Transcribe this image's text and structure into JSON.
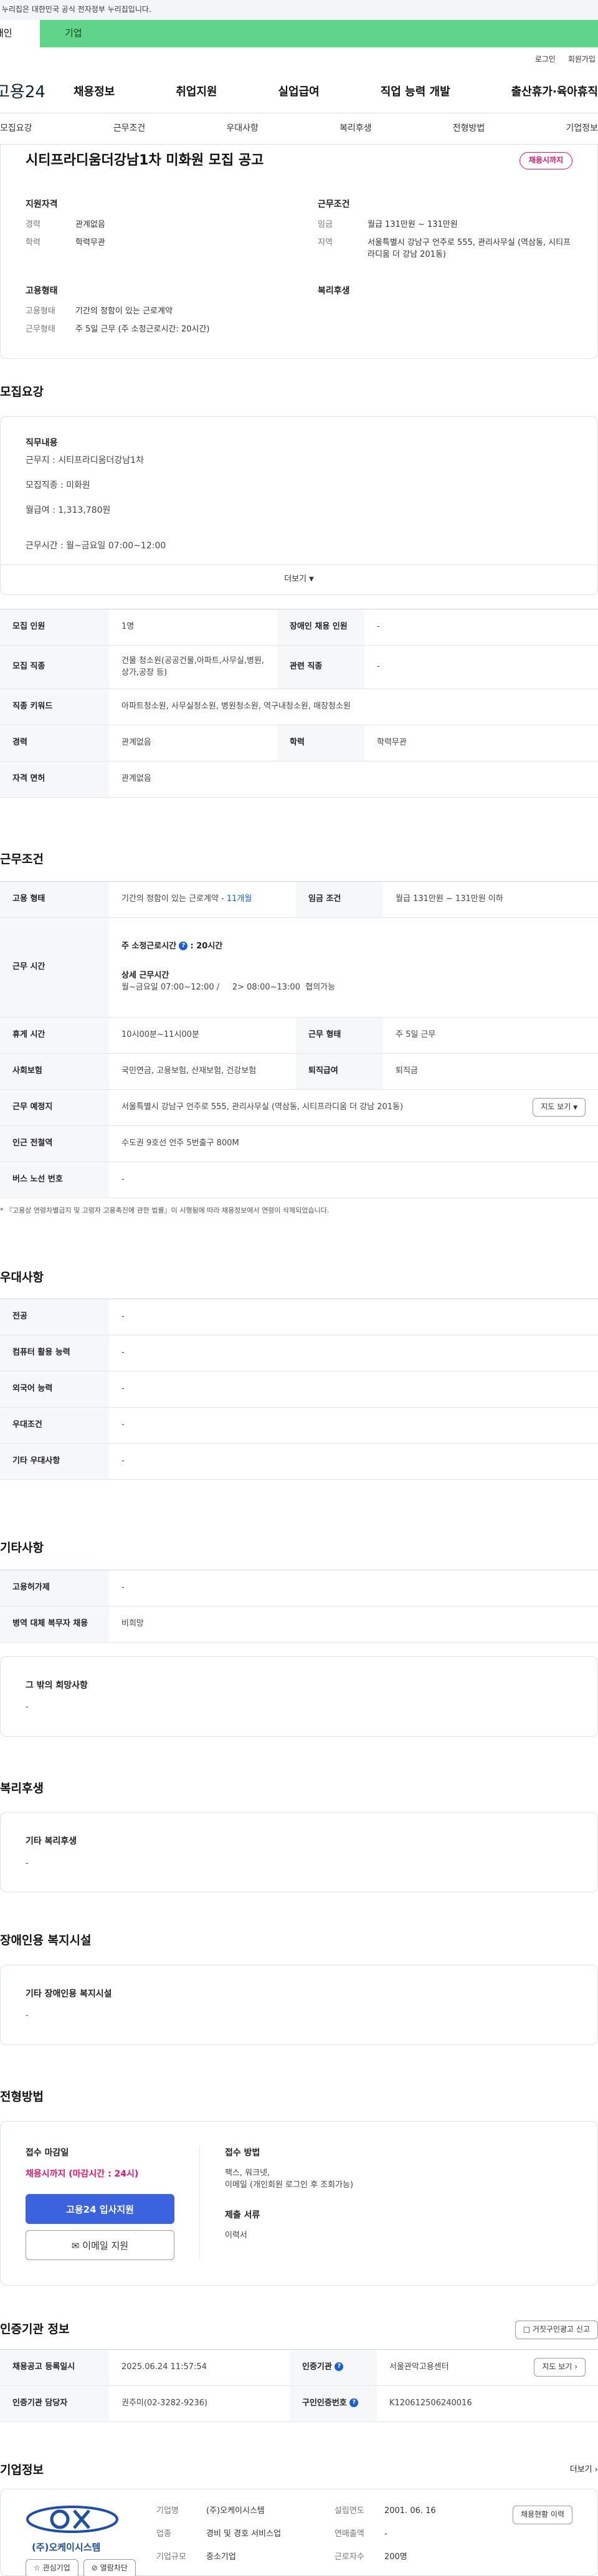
{
  "gov_notice": "이 누리집은 대한민국 공식 전자정부 누리집입니다.",
  "tabs": {
    "individual": "개인",
    "company": "기업"
  },
  "util": {
    "login": "로그인",
    "signup": "회원가입"
  },
  "logo": "고용24",
  "gnb": [
    "채용정보",
    "취업지원",
    "실업급여",
    "직업 능력 개발",
    "출산휴가·육아휴직"
  ],
  "subnav": [
    "모집요강",
    "근무조건",
    "우대사항",
    "복리후생",
    "전형방법",
    "기업정보"
  ],
  "summary": {
    "title": "시티프라디움더강남1차 미화원 모집 공고",
    "status": "채용시까지",
    "qual_h": "지원자격",
    "qual": [
      {
        "k": "경력",
        "v": "관계없음"
      },
      {
        "k": "학력",
        "v": "학력무관"
      }
    ],
    "cond_h": "근무조건",
    "cond": [
      {
        "k": "임금",
        "v": "월급 131만원 ~ 131만원"
      },
      {
        "k": "지역",
        "v": "서울특별시 강남구 언주로 555, 관리사무실 (역삼동, 시티프라디움 더 강남 201동)"
      }
    ],
    "emp_h": "고용형태",
    "emp": [
      {
        "k": "고용형태",
        "v": "기간의 정함이 있는 근로계약"
      },
      {
        "k": "근무형태",
        "v": "주 5일 근무 (주 소정근로시간: 20시간)"
      }
    ],
    "welfare_h": "복리후생"
  },
  "recruit": {
    "title": "모집요강",
    "duty_h": "직무내용",
    "lines": [
      "근무지 : 시티프라디움더강남1차",
      "모집직종 : 미화원",
      "월급여 : 1,313,780원",
      "근무시간 :  월~금요일 07:00~12:00"
    ],
    "more": "더보기",
    "table": {
      "count_k": "모집 인원",
      "count_v": "1명",
      "disabled_k": "장애인 채용 인원",
      "disabled_v": "-",
      "job_k": "모집 직종",
      "job_v": "건물 청소원(공공건물,아파트,사무실,병원,상가,공장 등)",
      "related_k": "관련 직종",
      "related_v": "-",
      "keyword_k": "직종 키워드",
      "keyword_v": "아파트청소원, 사무실청소원, 병원청소원, 역구내청소원, 매장청소원",
      "career_k": "경력",
      "career_v": "관계없음",
      "edu_k": "학력",
      "edu_v": "학력무관",
      "license_k": "자격 면허",
      "license_v": "관계없음"
    }
  },
  "work": {
    "title": "근무조건",
    "type_k": "고용 형태",
    "type_v": "기간의 정함이 있는 근로계약 -",
    "type_months": "11개월",
    "wage_k": "임금 조건",
    "wage_v": "월급 131만원 ~ 131만원 이하",
    "hours_k": "근무 시간",
    "hours_weekly": "주 소정근로시간",
    "hours_weekly_v": ": 20시간",
    "hours_detail_h": "상세 근무시간",
    "hours_detail_v": "월~금요일 07:00~12:00 /     2> 08:00~13:00  협의가능",
    "break_k": "휴게 시간",
    "break_v": "10시00분~11시00분",
    "form_k": "근무 형태",
    "form_v": "주 5일 근무",
    "insurance_k": "사회보험",
    "insurance_v": "국민연금, 고용보험, 산재보험, 건강보험",
    "severance_k": "퇴직급여",
    "severance_v": "퇴직금",
    "place_k": "근무 예정지",
    "place_v": "서울특별시 강남구 언주로 555, 관리사무실 (역삼동, 시티프라디움 더 강남 201동)",
    "map_btn": "지도 보기",
    "subway_k": "인근 전철역",
    "subway_v": "수도권 9호선 언주 5번출구 800M",
    "bus_k": "버스 노선 번호",
    "bus_v": "-",
    "footnote": "* 『고용상 연령차별금지 및 고령자 고용촉진에 관한 법률』이 시행됨에 따라 채용정보에서 연령이 삭제되었습니다."
  },
  "pref": {
    "title": "우대사항",
    "rows": [
      {
        "k": "전공",
        "v": "-"
      },
      {
        "k": "컴퓨터 활용 능력",
        "v": "-"
      },
      {
        "k": "외국어 능력",
        "v": "-"
      },
      {
        "k": "우대조건",
        "v": "-"
      },
      {
        "k": "기타 우대사항",
        "v": "-"
      }
    ]
  },
  "etc": {
    "title": "기타사항",
    "rows": [
      {
        "k": "고용허가제",
        "v": "-"
      },
      {
        "k": "병역 대체 복무자 채용",
        "v": "비희망"
      }
    ],
    "other_h": "그 밖의 희망사항",
    "other_v": "-"
  },
  "welfare": {
    "title": "복리후생",
    "box_h": "기타 복리후생",
    "box_v": "-"
  },
  "disabled": {
    "title": "장애인용 복지시설",
    "box_h": "기타 장애인용 복지시설",
    "box_v": "-"
  },
  "process": {
    "title": "전형방법",
    "deadline_h": "접수 마감일",
    "deadline_v": "채용시까지 (마감시간 : 24시)",
    "apply_btn": "고용24 입사지원",
    "email_btn": "이메일 지원",
    "method_h": "접수 방법",
    "method_v1": "팩스, 워크넷,",
    "method_v2": "이메일 (개인회원 로그인 후 조회가능)",
    "docs_h": "제출 서류",
    "docs_v": "이력서"
  },
  "cert": {
    "title": "인증기관 정보",
    "report_btn": "거짓구인광고 신고",
    "reg_k": "채용공고 등록일시",
    "reg_v": "2025.06.24 11:57:54",
    "org_k": "인증기관",
    "org_v": "서울관악고용센터",
    "map_btn": "지도 보기",
    "mgr_k": "인증기관 담당자",
    "mgr_v": "권주미(02-3282-9236)",
    "no_k": "구인인증번호",
    "no_v": "K120612506240016"
  },
  "company": {
    "title": "기업정보",
    "more": "더보기",
    "logo_text": "(주)오케이시스템",
    "fav_btn": "관심기업",
    "block_btn": "열람차단",
    "name_k": "기업명",
    "name_v": "(주)오케이시스템",
    "est_k": "설립연도",
    "est_v": "2001. 06. 16",
    "biz_k": "업종",
    "biz_v": "경비 및 경호 서비스업",
    "sales_k": "연매출액",
    "sales_v": "-",
    "size_k": "기업규모",
    "size_v": "중소기업",
    "emp_k": "근로자수",
    "emp_v": "200명",
    "history_btn": "채용현황 이력"
  }
}
